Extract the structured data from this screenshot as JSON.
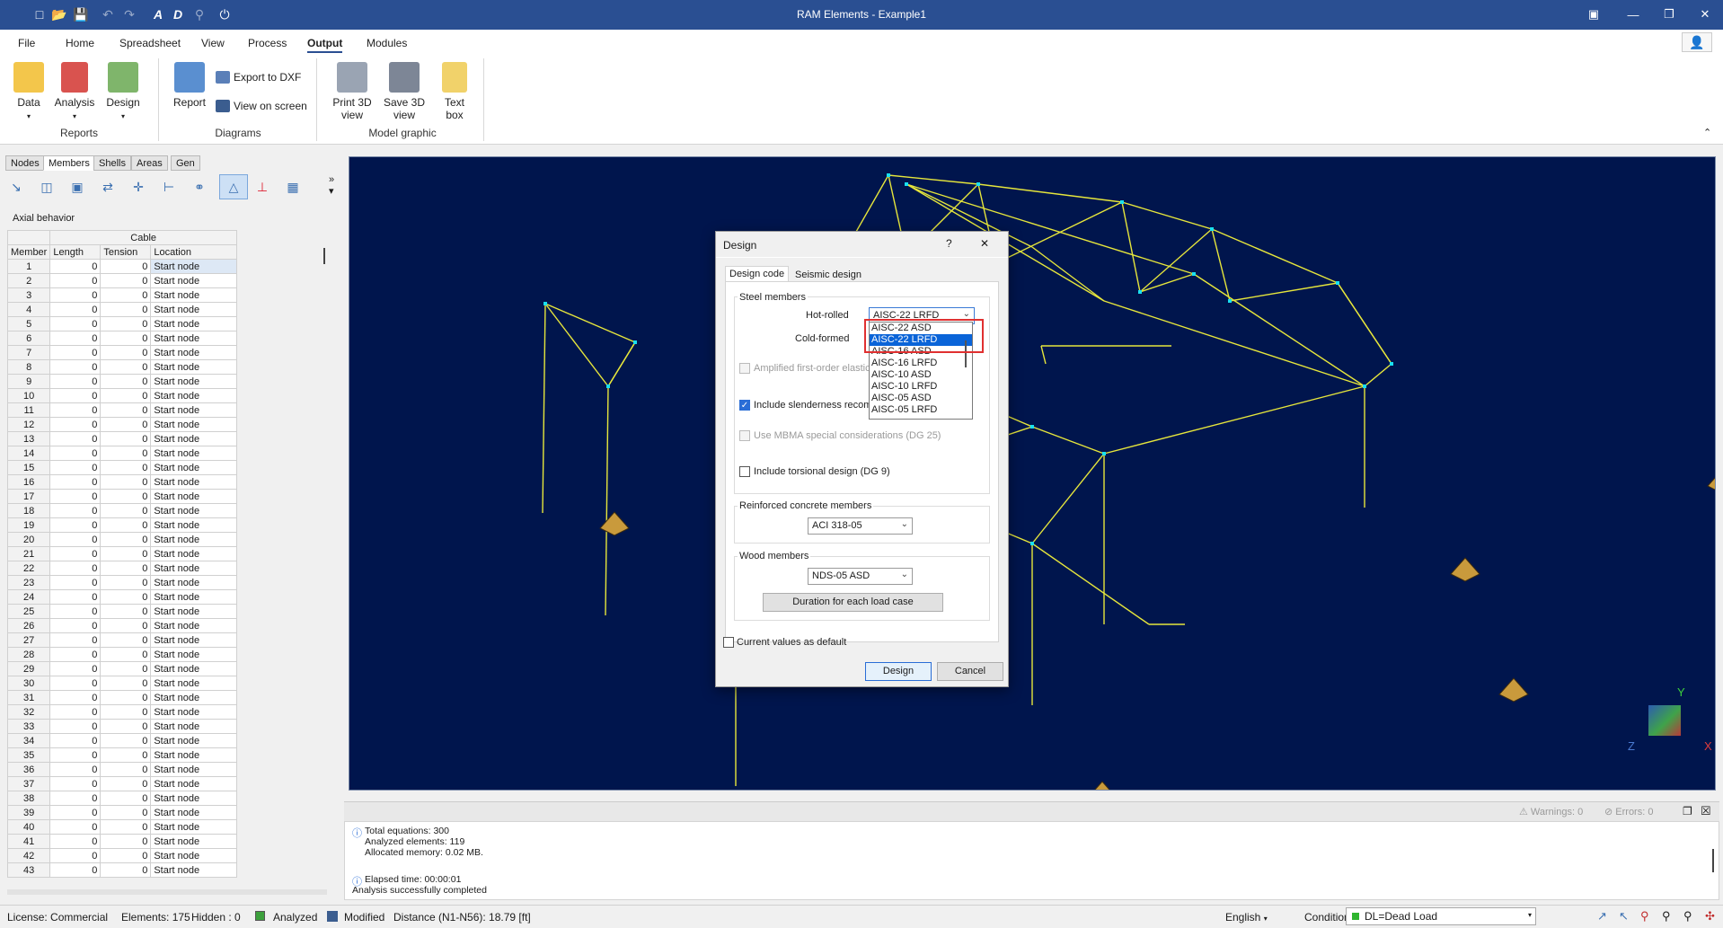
{
  "titlebar": {
    "title": "RAM Elements - Example1",
    "quick_access": [
      "new-icon",
      "open-icon",
      "save-icon",
      "undo-icon",
      "redo-icon",
      "text-a-icon",
      "text-d-icon",
      "query-icon",
      "power-icon"
    ],
    "window_controls": [
      "ribbon-display-icon",
      "minimize-icon",
      "restore-icon",
      "close-icon"
    ]
  },
  "menu": {
    "tabs": [
      "File",
      "Home",
      "Spreadsheet",
      "View",
      "Process",
      "Output",
      "Modules"
    ],
    "active": "Output"
  },
  "ribbon": {
    "reports": {
      "data": "Data",
      "analysis": "Analysis",
      "design": "Design",
      "group": "Reports"
    },
    "diagrams": {
      "report": "Report",
      "export_dxf": "Export to DXF",
      "view_on_screen": "View on screen",
      "group": "Diagrams"
    },
    "model_graphic": {
      "print_3d": "Print 3D view",
      "save_3d": "Save 3D view",
      "text_box": "Text box",
      "group": "Model graphic"
    }
  },
  "left_panel": {
    "tabs": [
      "Nodes",
      "Members",
      "Shells",
      "Areas",
      "Gen"
    ],
    "active_tab": "Members",
    "section_title": "Axial behavior",
    "group_header": "Cable",
    "columns": [
      "Member",
      "Length",
      "Tension",
      "Location"
    ],
    "rows_count_text": "",
    "row_length": "0",
    "row_tension": "0",
    "row_location": "Start node",
    "rows": [
      "1",
      "2",
      "3",
      "4",
      "5",
      "6",
      "7",
      "8",
      "9",
      "10",
      "11",
      "12",
      "13",
      "14",
      "15",
      "16",
      "17",
      "18",
      "19",
      "20",
      "21",
      "22",
      "23",
      "24",
      "25",
      "26",
      "27",
      "28",
      "29",
      "30",
      "31",
      "32",
      "33",
      "34",
      "35",
      "36",
      "37",
      "38",
      "39",
      "40",
      "41",
      "42",
      "43"
    ]
  },
  "log": {
    "warnings": "Warnings: 0",
    "errors": "Errors: 0",
    "line1": "Total equations: 300",
    "line2": "Analyzed elements: 119",
    "line3": "Allocated memory: 0.02 MB.",
    "line4": "Elapsed time: 00:00:01",
    "line5": "Analysis successfully completed"
  },
  "status": {
    "license": "License: Commercial",
    "elements": "Elements: 175",
    "hidden": "Hidden : 0",
    "analyzed": "Analyzed",
    "modified": "Modified",
    "distance": "Distance (N1-N56): 18.79 [ft]",
    "language": "English",
    "conditions_label": "Conditions:",
    "conditions_value": "DL=Dead Load"
  },
  "dialog": {
    "title": "Design",
    "help": "?",
    "close": "✕",
    "tabs": [
      "Design code",
      "Seismic design"
    ],
    "steel_group": "Steel members",
    "hot_rolled_label": "Hot-rolled",
    "hot_rolled_value": "AISC-22 LRFD",
    "cold_formed_label": "Cold-formed",
    "dropdown_options": [
      "AISC-22 ASD",
      "AISC-22 LRFD",
      "AISC-16 ASD",
      "AISC-16 LRFD",
      "AISC-10 ASD",
      "AISC-10 LRFD",
      "AISC-05 ASD",
      "AISC-05 LRFD"
    ],
    "dropdown_selected": "AISC-22 LRFD",
    "amplified_label": "Amplified first-order elastic",
    "slenderness_label": "Include slenderness recom",
    "mbma_label": "Use MBMA special considerations (DG 25)",
    "torsional_label": "Include torsional design (DG 9)",
    "concrete_group": "Reinforced concrete members",
    "concrete_value": "ACI 318-05",
    "wood_group": "Wood members",
    "wood_value": "NDS-05 ASD",
    "duration_button": "Duration for each load case",
    "current_default_label": "Current values as default",
    "design_button": "Design",
    "cancel_button": "Cancel"
  },
  "viewport": {
    "axis_x": "X",
    "axis_y": "Y",
    "axis_z": "Z",
    "background": "#00154d",
    "frame_color": "#e6e63c",
    "node_color": "#19e0f0"
  }
}
